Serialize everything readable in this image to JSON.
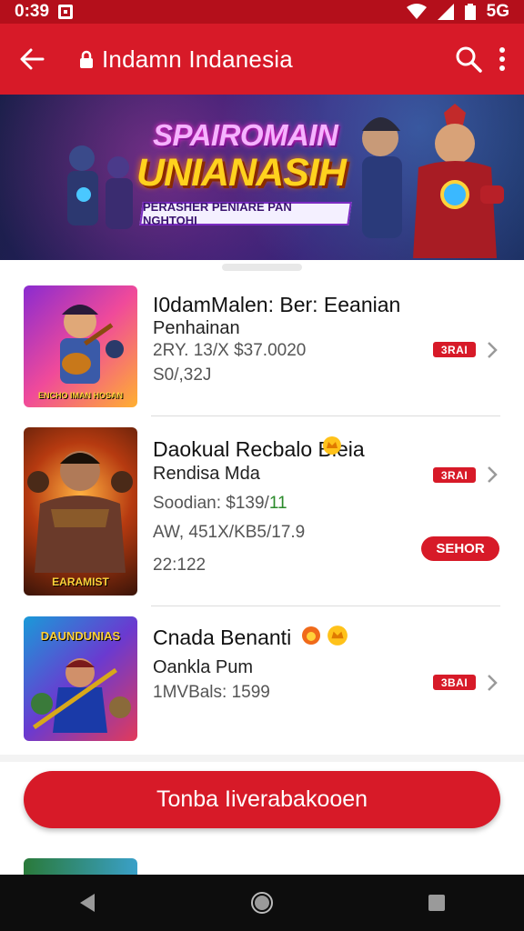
{
  "status_bar": {
    "time": "0:39",
    "carrier": "5G"
  },
  "app_bar": {
    "title": "Indamn Indanesia"
  },
  "banner": {
    "headline_top": "SPAIROMAIN",
    "headline_main": "UNIANASIH",
    "subtitle": "PERASHER PENIARE PAN NGHTOHI"
  },
  "items": [
    {
      "name": "I0damMalen: Ber: Eeanian",
      "subtitle": "Penhainan",
      "meta1": "2RY. 13/X $37.0020",
      "meta2": "S0/,32J",
      "badge": "3RAI",
      "thumb_caption": "ENCHO IMAN HOSAN"
    },
    {
      "name": "Daokual Recbalo Bleia",
      "subtitle": "Rendisa Mda",
      "meta1_prefix": "Soodian: $139/",
      "meta1_green": "11",
      "meta2": "AW, 451X/KB5/17.9",
      "meta3": "22:122",
      "badge": "3RAI",
      "pill": "SEHOR",
      "thumb_caption": "EARAMIST"
    },
    {
      "name": "Cnada Benanti",
      "subtitle": "Oankla Pum",
      "meta1": "1MVBals:   1599",
      "badge": "3BAI",
      "thumb_caption": "DAUNDUNIAS"
    }
  ],
  "cta": {
    "label": "Tonba Iiverabakooen"
  },
  "colors": {
    "brand": "#d71a28",
    "status_bar": "#b40f1b",
    "nav_bar": "#0d0d0d"
  }
}
